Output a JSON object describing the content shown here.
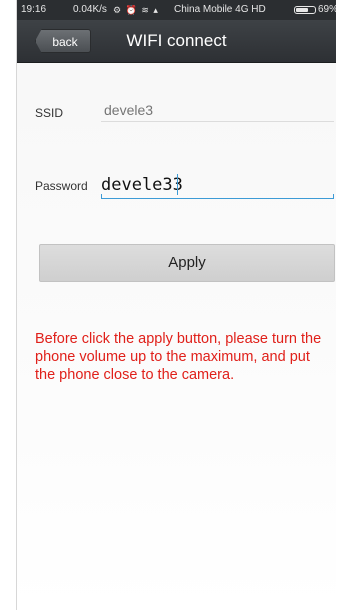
{
  "status_bar": {
    "time": "19:16",
    "speed": "0.04K/s",
    "icons": [
      "settings-icon",
      "alarm-icon",
      "wifi-icon",
      "signal-icon"
    ],
    "carrier": "China Mobile 4G HD",
    "battery_percent": "69%",
    "battery_level": 0.69
  },
  "header": {
    "back_label": "back",
    "title": "WIFI connect"
  },
  "form": {
    "ssid_label": "SSID",
    "ssid_placeholder": "devele3",
    "password_label": "Password",
    "password_value": "devele33"
  },
  "apply_label": "Apply",
  "warning_text": "Before click the apply button, please turn the phone volume up to the maximum, and put the phone close to the camera.",
  "colors": {
    "title_bar": "#2d3034",
    "warning": "#e0201a",
    "focus_line": "#3d9bd6"
  }
}
